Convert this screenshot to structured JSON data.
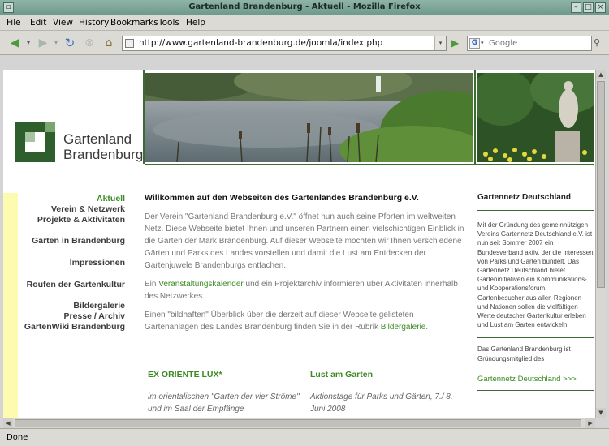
{
  "window": {
    "title": "Gartenland Brandenburg - Aktuell - Mozilla Firefox"
  },
  "menu": {
    "items": [
      "File",
      "Edit",
      "View",
      "History",
      "Bookmarks",
      "Tools",
      "Help"
    ]
  },
  "toolbar": {
    "url": "http://www.gartenland-brandenburg.de/joomla/index.php",
    "search_placeholder": "Google"
  },
  "status": {
    "text": "Done"
  },
  "logo": {
    "line1": "Gartenland",
    "line2": "Brandenburg"
  },
  "nav": {
    "items": [
      "Aktuell",
      "Verein & Netzwerk",
      "Projekte & Aktivitäten",
      "Gärten in Brandenburg",
      "Impressionen",
      "Roufen der Gartenkultur",
      "Bildergalerie",
      "Presse / Archiv",
      "GartenWiki Brandenburg"
    ]
  },
  "main": {
    "heading": "Willkommen auf den Webseiten des Gartenlandes Brandenburg e.V.",
    "p1": "Der Verein \"Gartenland Brandenburg e.V.\" öffnet nun auch seine Pforten im weltweiten Netz. Diese Webseite bietet Ihnen und unseren Partnern einen vielschichtigen Einblick in die Gärten der Mark Brandenburg. Auf dieser Webseite möchten wir Ihnen verschiedene Gärten und Parks des Landes vorstellen und damit die Lust am Entdecken der Gartenjuwele Brandenburgs entfachen.",
    "p2_pre": "Ein ",
    "p2_link": "Veranstaltungskalender",
    "p2_post": " und ein Projektarchiv informieren über Aktivitäten innerhalb des Netzwerkes.",
    "p3_pre": "Einen \"bildhaften\" Überblick über die derzeit auf dieser Webseite gelisteten Gartenanlagen des Landes Brandenburg finden Sie in der Rubrik ",
    "p3_link": "Bildergalerie",
    "p3_post": "."
  },
  "events": [
    {
      "title": "EX ORIENTE LUX*",
      "desc": "im orientalischen \"Garten der vier Ströme\" und im Saal der Empfänge"
    },
    {
      "title": "Lust am Garten",
      "desc": "Aktionstage für Parks und Gärten, 7./ 8. Juni 2008"
    }
  ],
  "sidebar": {
    "heading": "Gartennetz Deutschland",
    "text1": "Mit der Gründung des gemeinnützigen Vereins Gartennetz Deutschland e.V. ist nun seit Sommer 2007 ein Bundesverband aktiv, der die Interessen von Parks und Gärten bündelt. Das Gartennetz Deutschland bietet Garteninitiativen ein Kommunikations- und Kooperationsforum. Gartenbesucher aus allen Regionen und Nationen sollen die vielfältigen Werte deutscher Gartenkultur erleben und Lust am Garten entwickeln.",
    "text2": "Das Gartenland Brandenburg ist Gründungsmitglied des",
    "link": "Gartennetz Deutschland >>>"
  },
  "colors": {
    "brand_green": "#3c8a24",
    "dark_green": "#2e5e2c",
    "nav_yellow": "#fdfbb0"
  }
}
